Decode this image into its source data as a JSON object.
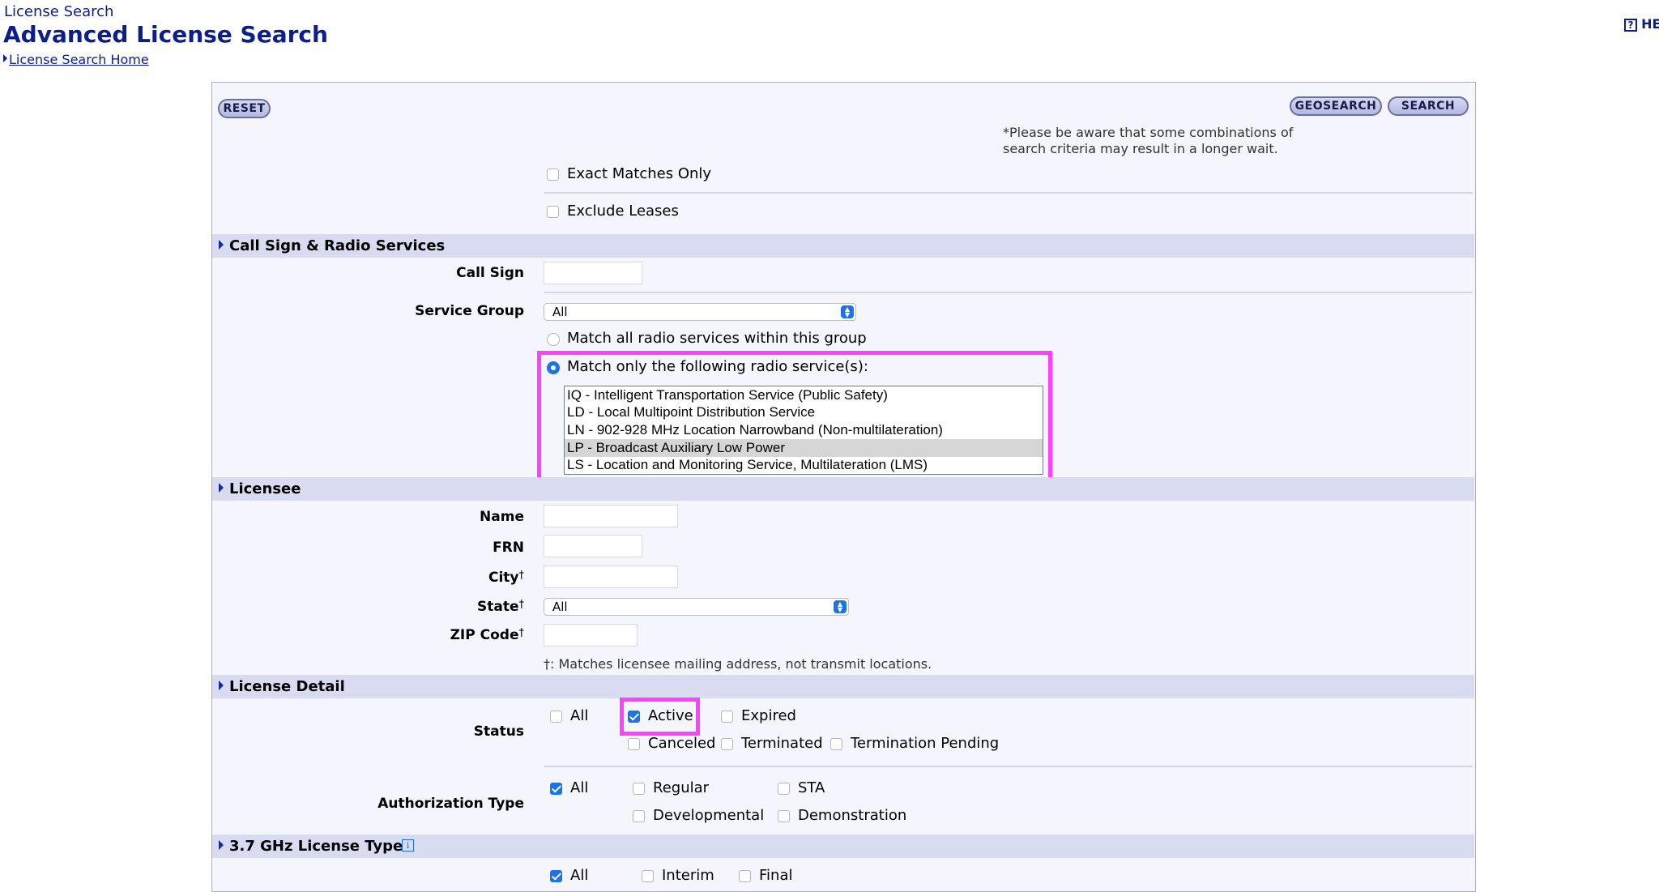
{
  "header": {
    "crumb": "License Search",
    "title": "Advanced License Search",
    "home_link": "License Search Home",
    "help_label": "HE"
  },
  "toolbar": {
    "reset": "RESET",
    "geosearch": "GEOSEARCH",
    "search": "SEARCH",
    "notice_line1": "*Please be aware that some combinations of",
    "notice_line2": "search criteria may result in a longer wait."
  },
  "general": {
    "exact_matches": "Exact Matches Only",
    "exclude_leases": "Exclude Leases"
  },
  "call_sign_section": {
    "title": "Call Sign & Radio Services",
    "call_sign_label": "Call Sign",
    "call_sign_value": "",
    "service_group_label": "Service Group",
    "service_group_value": "All",
    "match_all": "Match all radio services within this group",
    "match_only": "Match only the following radio service(s):",
    "services": [
      "IQ - Intelligent Transportation Service (Public Safety)",
      "LD - Local Multipoint Distribution Service",
      "LN - 902-928 MHz Location Narrowband (Non-multilateration)",
      "LP - Broadcast Auxiliary Low Power",
      "LS - Location and Monitoring Service, Multilateration (LMS)"
    ]
  },
  "licensee_section": {
    "title": "Licensee",
    "name_label": "Name",
    "frn_label": "FRN",
    "city_label": "City",
    "state_label": "State",
    "state_value": "All",
    "zip_label": "ZIP Code",
    "dagger": "†",
    "footnote": "†: Matches licensee mailing address, not transmit locations."
  },
  "license_detail_section": {
    "title": "License Detail",
    "status_label": "Status",
    "status_all": "All",
    "status_active": "Active",
    "status_expired": "Expired",
    "status_canceled": "Canceled",
    "status_terminated": "Terminated",
    "status_termination_pending": "Termination Pending",
    "auth_label": "Authorization Type",
    "auth_all": "All",
    "auth_regular": "Regular",
    "auth_sta": "STA",
    "auth_developmental": "Developmental",
    "auth_demonstration": "Demonstration"
  },
  "ghz_section": {
    "title": "3.7 GHz License Type",
    "info_icon": "i",
    "all": "All",
    "interim": "Interim",
    "final": "Final"
  },
  "colors": {
    "title_blue": "#0b1e8c",
    "section_band": "#d9dcf0",
    "panel_bg": "#f5f5fd",
    "highlight": "#ff40ff",
    "checked_blue": "#1a73e8"
  }
}
